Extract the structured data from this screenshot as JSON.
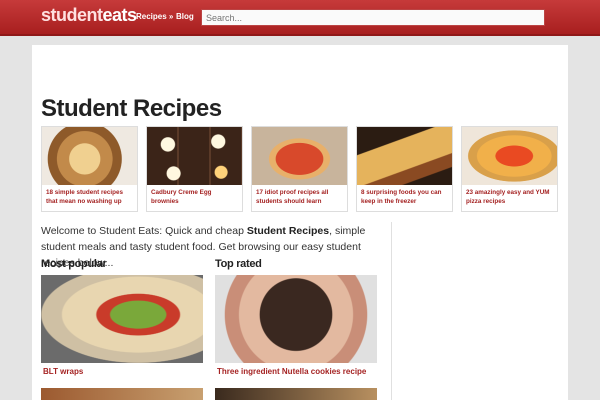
{
  "header": {
    "logo_part1": "student",
    "logo_part2": "eats",
    "nav": {
      "recipes": "Recipes »",
      "blog": "Blog"
    },
    "search_placeholder": "Search..."
  },
  "page_title": "Student Recipes",
  "featured": [
    {
      "caption": "18 simple student recipes that mean no washing up"
    },
    {
      "caption": "Cadbury Creme Egg brownies"
    },
    {
      "caption": "17 idiot proof recipes all students should learn"
    },
    {
      "caption": "8 surprising foods you can keep in the freezer"
    },
    {
      "caption": "23 amazingly easy and YUM pizza recipes"
    }
  ],
  "intro": {
    "before": "Welcome to Student Eats: Quick and cheap ",
    "bold": "Student Recipes",
    "after": ", simple student meals and tasty student food. Get browsing our easy student recipes below..."
  },
  "most_popular": {
    "heading": "Most popular",
    "title": "BLT wraps"
  },
  "top_rated": {
    "heading": "Top rated",
    "title": "Three ingredient Nutella cookies recipe"
  },
  "colors": {
    "brand_red": "#b22222",
    "link_red": "#a52323"
  }
}
